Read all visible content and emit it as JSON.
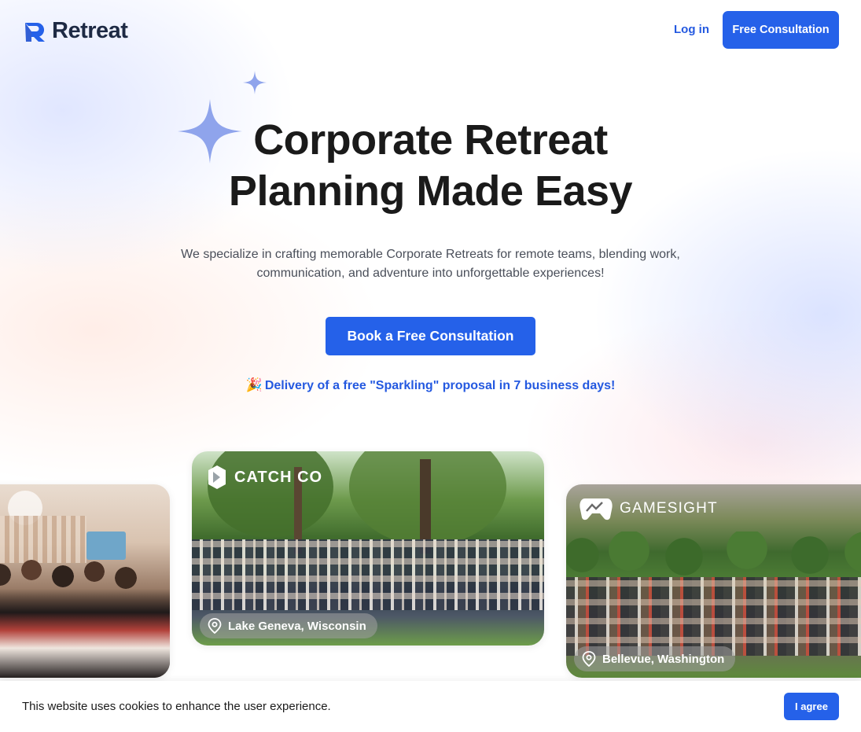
{
  "brand": {
    "name": "Retreat",
    "accent": "#2561e9"
  },
  "header": {
    "login_label": "Log in",
    "cta_label": "Free Consultation"
  },
  "hero": {
    "title_line1": "Corporate Retreat",
    "title_line2": "Planning Made Easy",
    "subtitle": "We specialize in crafting memorable Corporate Retreats for remote teams, blending work, communication, and adventure into unforgettable experiences!",
    "cta_label": "Book a Free Consultation",
    "promo_emoji": "🎉",
    "promo_text": "Delivery of a free \"Sparkling\" proposal in 7 business days!"
  },
  "gallery": {
    "cards": [
      {
        "brand": "",
        "location": ""
      },
      {
        "brand": "CATCH CO",
        "location": "Lake Geneva, Wisconsin"
      },
      {
        "brand": "GAMESIGHT",
        "location": "Bellevue, Washington"
      }
    ]
  },
  "cookie": {
    "message": "This website uses cookies to enhance the user experience.",
    "agree_label": "I agree"
  },
  "icons": [
    "retreat-logo-icon",
    "sparkle-icon",
    "party-popper-icon",
    "location-pin-icon",
    "catchco-logo-icon",
    "gamesight-logo-icon"
  ]
}
